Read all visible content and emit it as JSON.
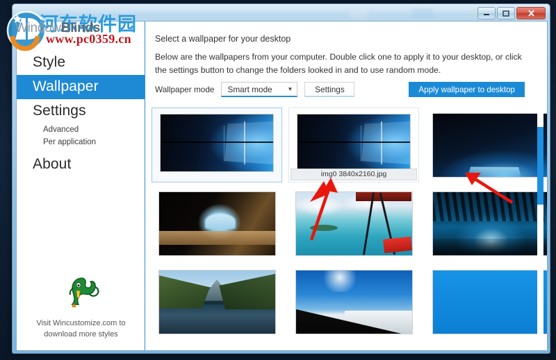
{
  "window": {
    "controls": {
      "minimize_label": "Minimize",
      "maximize_label": "Maximize",
      "close_label": "Close"
    }
  },
  "watermark": {
    "site_name_cn": "河东软件园",
    "site_url": "www.pc0359.cn"
  },
  "brand": {
    "name_light": "Window",
    "name_bold": "Blinds"
  },
  "sidebar": {
    "items": [
      {
        "label": "Style",
        "active": false,
        "sub": false
      },
      {
        "label": "Wallpaper",
        "active": true,
        "sub": false
      },
      {
        "label": "Settings",
        "active": false,
        "sub": false
      },
      {
        "label": "Advanced",
        "active": false,
        "sub": true
      },
      {
        "label": "Per application",
        "active": false,
        "sub": true
      },
      {
        "label": "About",
        "active": false,
        "sub": false
      }
    ],
    "promo": {
      "icon": "lizard-mascot-icon",
      "line1": "Visit Wincustomize.com to",
      "line2": "download more styles"
    }
  },
  "content": {
    "title": "Select a wallpaper for your desktop",
    "description": "Below are the wallpapers from your computer.  Double click one to apply it to your desktop, or click the settings button to change the folders looked in and to use random mode.",
    "toolbar": {
      "mode_label": "Wallpaper mode",
      "mode_value": "Smart mode",
      "mode_options": [
        "Smart mode"
      ],
      "settings_button": "Settings",
      "apply_button": "Apply wallpaper to desktop"
    },
    "tooltip": "img0 3840x2160.jpg",
    "thumbnails": [
      {
        "art": "w10",
        "selected": true,
        "framed": false,
        "tooltip": null
      },
      {
        "art": "w10",
        "selected": false,
        "framed": true,
        "tooltip": "img0 3840x2160.jpg"
      },
      {
        "art": "w10b",
        "selected": false,
        "framed": false,
        "tooltip": null
      },
      {
        "art": "cave",
        "selected": false,
        "framed": false,
        "tooltip": null
      },
      {
        "art": "lagoon",
        "selected": false,
        "framed": false,
        "tooltip": null
      },
      {
        "art": "icecave",
        "selected": false,
        "framed": false,
        "tooltip": null
      },
      {
        "art": "fjord",
        "selected": false,
        "framed": false,
        "tooltip": null
      },
      {
        "art": "summit",
        "selected": false,
        "framed": false,
        "tooltip": null
      },
      {
        "art": "plain-blue",
        "selected": false,
        "framed": false,
        "tooltip": null
      }
    ]
  },
  "colors": {
    "accent": "#1e8ad6",
    "apply_button": "#1b8ad6",
    "scrollbar": "#1e90e0",
    "annotation": "#e8160c"
  }
}
